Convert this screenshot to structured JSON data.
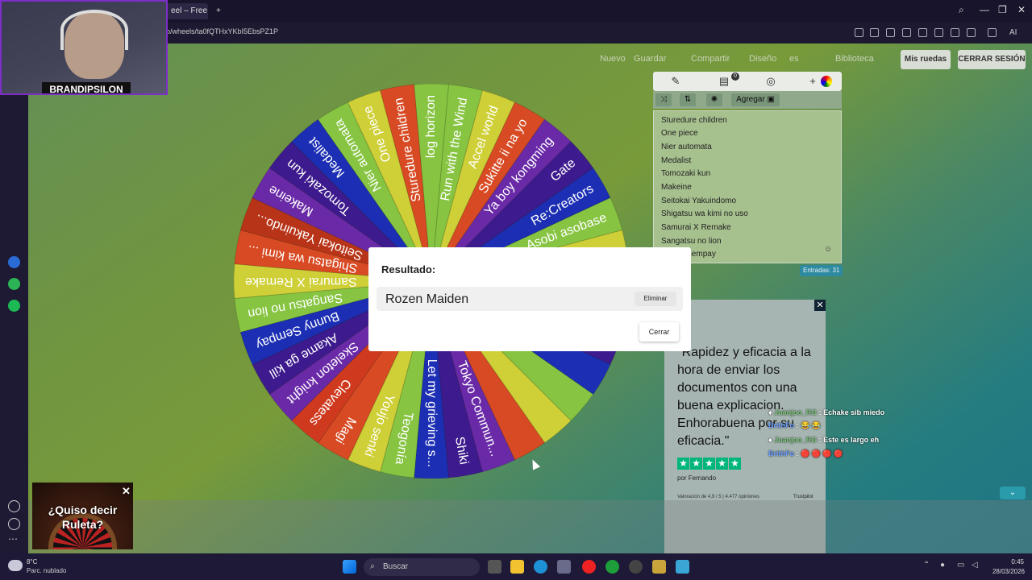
{
  "browser": {
    "tab_title": "eel – Free W",
    "new_tab": "+",
    "url": "o/wheels/ta0fQTHxYKbI5EbsPZ1P",
    "ai_label": "AI",
    "window_controls": [
      "search-icon",
      "minimize-icon",
      "restore-icon",
      "close-icon"
    ]
  },
  "webcam": {
    "label": "BRANDIPSILON"
  },
  "nav": {
    "nuevo": "Nuevo",
    "guardar": "Guardar",
    "compartir": "Compartir",
    "diseno": "Diseño",
    "lang": "es",
    "biblioteca": "Biblioteca",
    "mis_ruedas": "Mis ruedas",
    "cerrar_sesion": "CERRAR SESIÓN"
  },
  "wheel": {
    "segments": [
      {
        "label": "Run with the Wind",
        "color": "#86c441"
      },
      {
        "label": "Accel world",
        "color": "#cfcf37"
      },
      {
        "label": "Sukitte ii na yo",
        "color": "#d84a23"
      },
      {
        "label": "Ya boy kongming",
        "color": "#6a2aa8"
      },
      {
        "label": "Gate",
        "color": "#3d1a8d"
      },
      {
        "label": "Re:Creators",
        "color": "#1c2fb4"
      },
      {
        "label": "Asobi asobase",
        "color": "#86c441"
      },
      {
        "label": "",
        "color": "#cfcf37"
      },
      {
        "label": "",
        "color": "#d84a23"
      },
      {
        "label": "",
        "color": "#6a2aa8"
      },
      {
        "label": "",
        "color": "#3d1a8d"
      },
      {
        "label": "",
        "color": "#1c2fb4"
      },
      {
        "label": "",
        "color": "#86c441"
      },
      {
        "label": "",
        "color": "#cfcf37"
      },
      {
        "label": "",
        "color": "#d84a23"
      },
      {
        "label": "Tokyo Commun...",
        "color": "#6a2aa8"
      },
      {
        "label": "Shiki",
        "color": "#3d1a8d"
      },
      {
        "label": "Let my grieving s...",
        "color": "#1c2fb4"
      },
      {
        "label": "Teogonía",
        "color": "#86c441"
      },
      {
        "label": "Youjo senki",
        "color": "#cfcf37"
      },
      {
        "label": "Magi",
        "color": "#d84a23"
      },
      {
        "label": "Clevatess",
        "color": "#cf3a1f"
      },
      {
        "label": "Skeleton knight",
        "color": "#6a2aa8"
      },
      {
        "label": "Akame ga kill",
        "color": "#3d1a8d"
      },
      {
        "label": "Bunny Sempay",
        "color": "#1c2fb4"
      },
      {
        "label": "Sangatsu no lion",
        "color": "#86c441"
      },
      {
        "label": "Samurai X Remake",
        "color": "#cfcf37"
      },
      {
        "label": "Shigatsu wa kimi ...",
        "color": "#d84a23"
      },
      {
        "label": "Seitokai Yakuindo...",
        "color": "#b83418"
      },
      {
        "label": "Makeine",
        "color": "#6a2aa8"
      },
      {
        "label": "Tomozaki kun",
        "color": "#3d1a8d"
      },
      {
        "label": "Medalist",
        "color": "#1c2fb4"
      },
      {
        "label": "Nier automata",
        "color": "#86c441"
      },
      {
        "label": "One piece",
        "color": "#cfcf37"
      },
      {
        "label": "Sturedure children",
        "color": "#d84a23"
      },
      {
        "label": "log horizon",
        "color": "#86c441"
      }
    ]
  },
  "panel": {
    "tabs": [
      "pencil-icon",
      "clipboard-icon",
      "eye-off-icon",
      "plus-color-icon"
    ],
    "tab_badge": "0",
    "tools": [
      "shuffle-icon",
      "sort-icon",
      "settings-icon"
    ],
    "add_label": "Agregar",
    "entries": [
      "Sturedure children",
      "One piece",
      "Nier automata",
      "Medalist",
      "Tomozaki kun",
      "Makeine",
      "Seitokai Yakuindomo",
      "Shigatsu wa kimi no uso",
      "Samurai X Remake",
      "Sangatsu no lion",
      "Bunny Sempay"
    ],
    "entries_count": "Entradas: 31"
  },
  "ad": {
    "quote": "\"Rapidez y eficacia a la hora de enviar los documentos con una buena explicacion. Enhorabuena por su eficacia.\"",
    "by": "por Fernando",
    "rating": "Valoración de 4,9 / 5 | 4.477 opiniones",
    "tp": "Trustpilot"
  },
  "chat": [
    {
      "user": "Juanjoo_RG",
      "msg": "Echake sib miedo"
    },
    {
      "user": "BrithFo",
      "msg": "😂 😂"
    },
    {
      "user": "Juanjoo_RG",
      "msg": "Este es largo eh"
    },
    {
      "user": "BrithFo",
      "msg": "🔴 🔴 🔴 🔴"
    }
  ],
  "modal": {
    "title": "Resultado:",
    "result": "Rozen Maiden",
    "delete": "Eliminar",
    "close": "Cerrar"
  },
  "ruleta": {
    "text": "¿Quiso decir Ruleta?",
    "close": "✕"
  },
  "taskbar": {
    "temp": "8°C",
    "weather": "Parc. nublado",
    "search": "Buscar",
    "time": "0:45",
    "date": "28/03/2026"
  }
}
